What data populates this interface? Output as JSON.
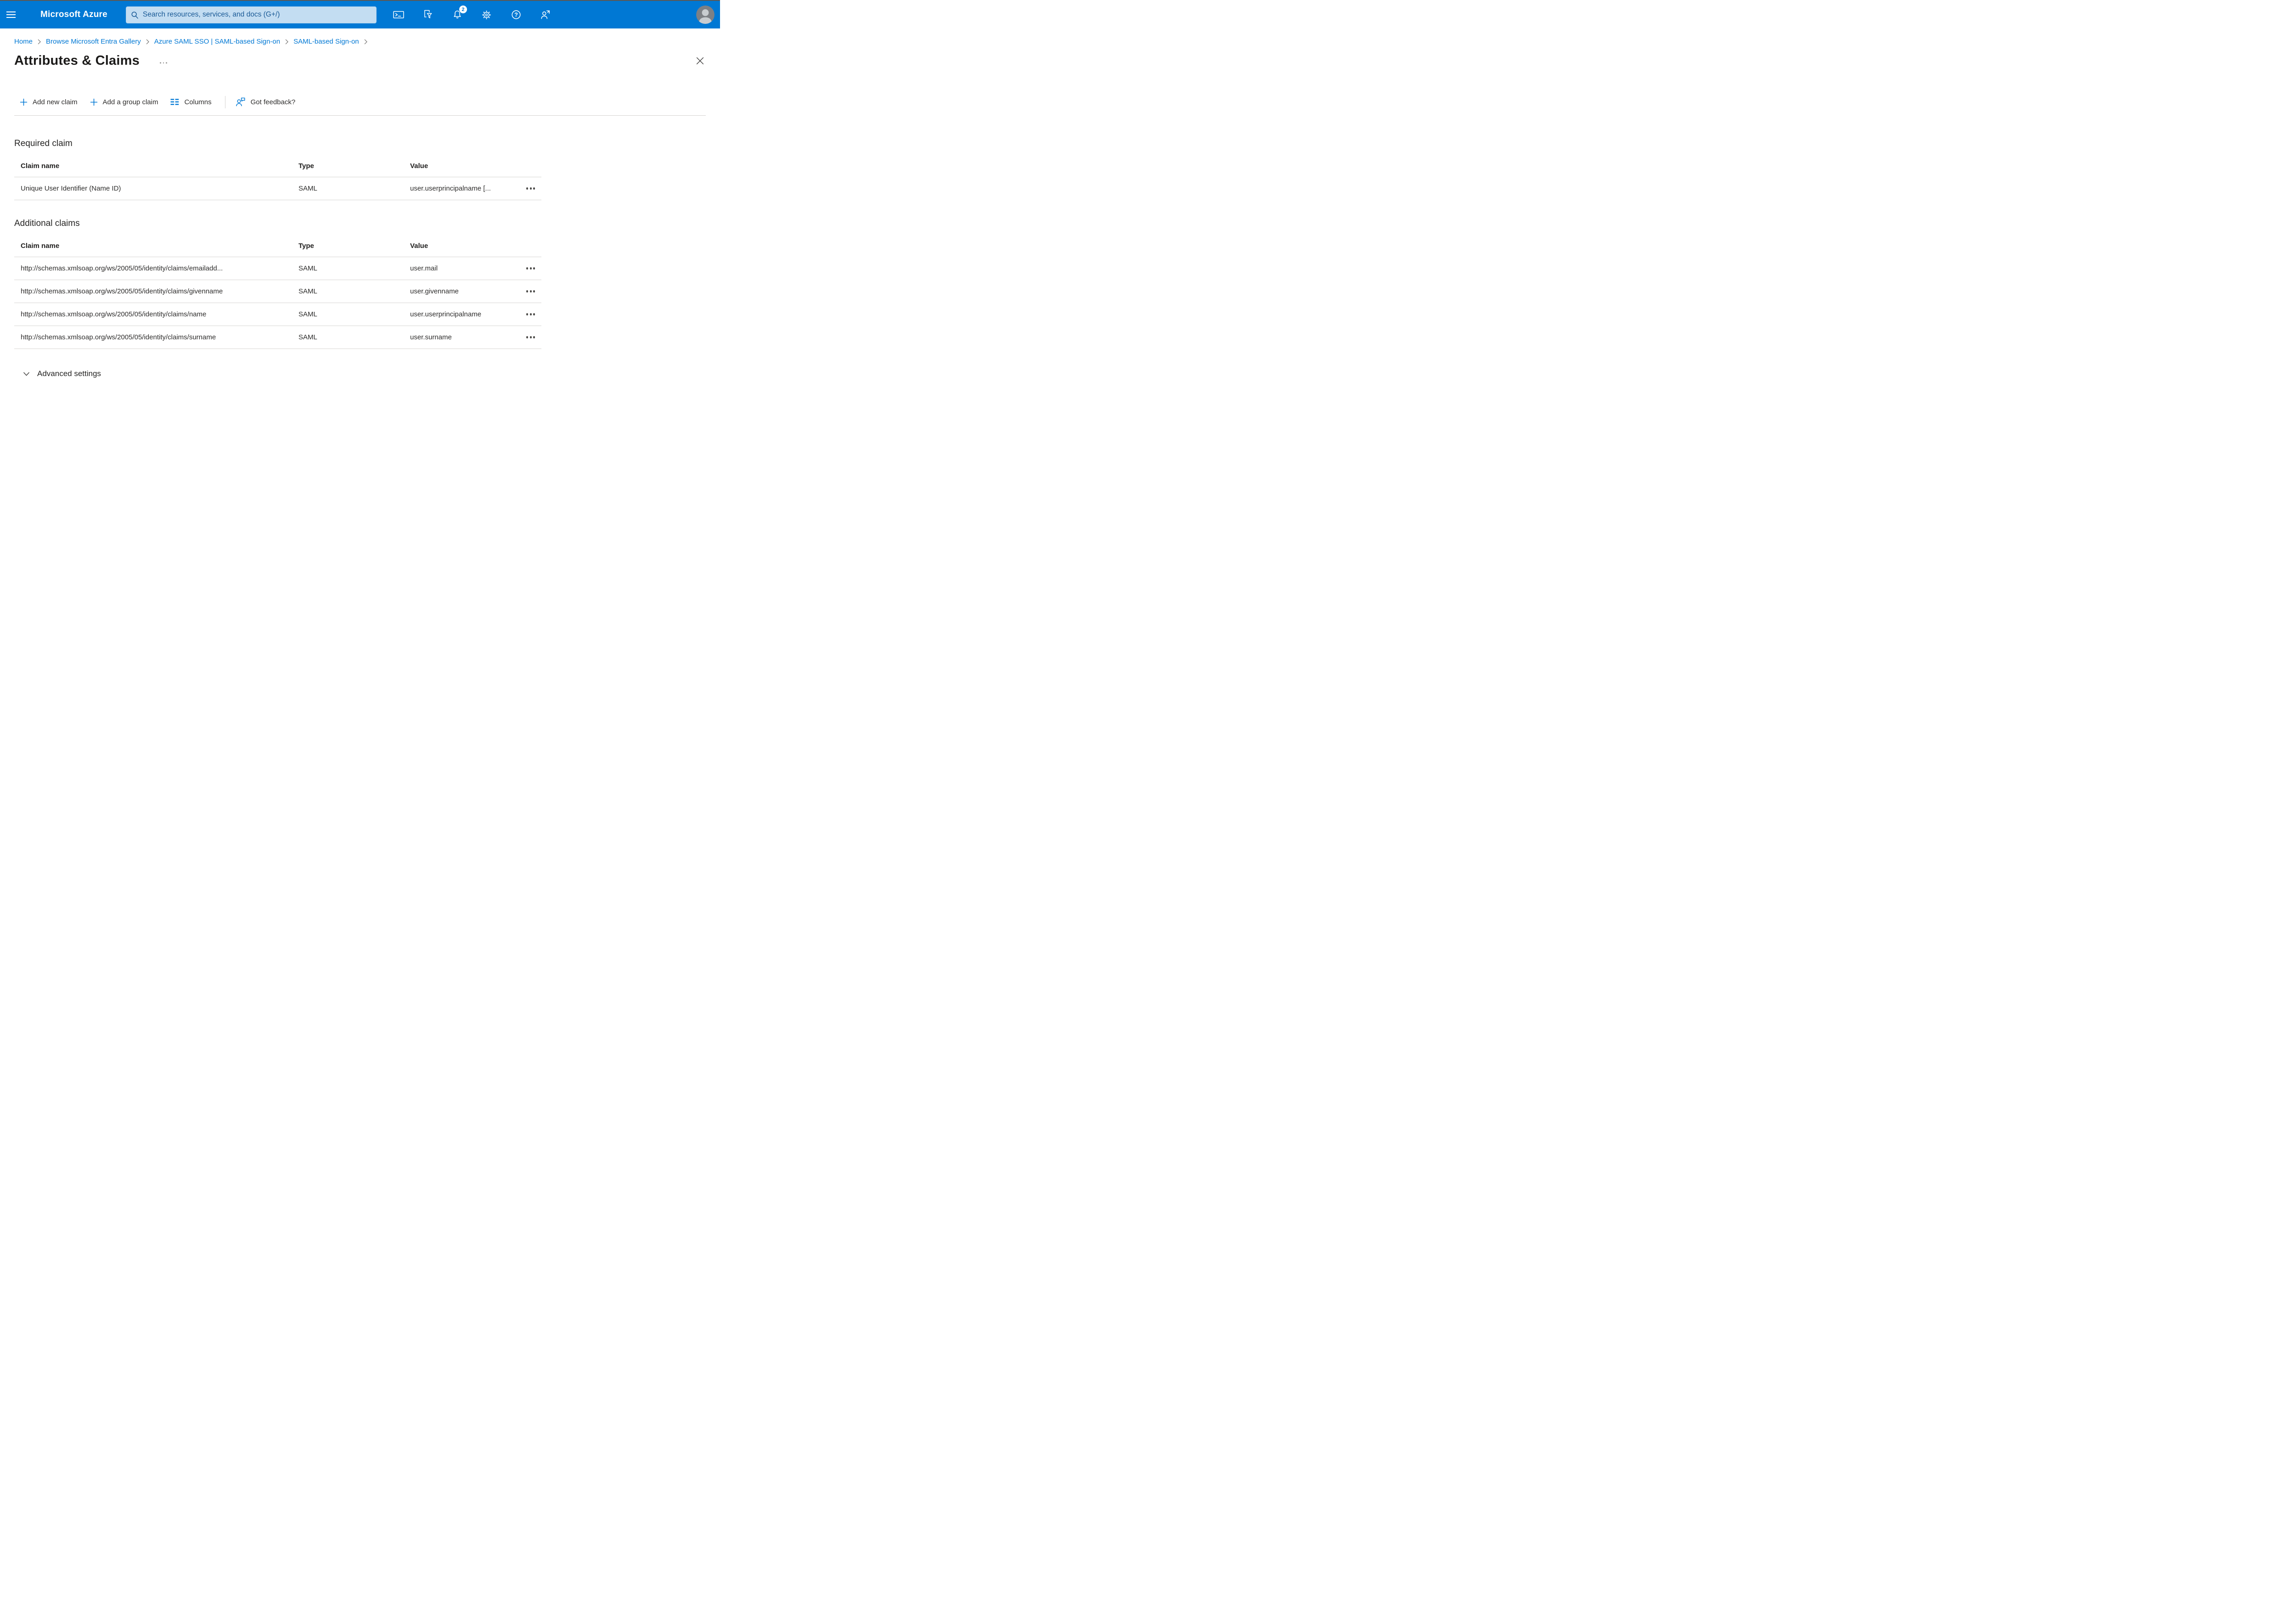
{
  "topbar": {
    "brand": "Microsoft Azure",
    "search_placeholder": "Search resources, services, and docs (G+/)",
    "notification_count": "2",
    "icons": [
      "hamburger-menu-icon",
      "search-icon",
      "cloud-shell-icon",
      "directory-filter-icon",
      "notifications-bell-icon",
      "settings-gear-icon",
      "help-icon",
      "person-arrow-icon",
      "avatar"
    ]
  },
  "colors": {
    "accent": "#0078d4",
    "topbar": "#0078d4",
    "search_bg": "#c3ddf2",
    "search_text": "#1a5a96"
  },
  "breadcrumb": {
    "items": [
      {
        "label": "Home"
      },
      {
        "label": "Browse Microsoft Entra Gallery"
      },
      {
        "label": "Azure SAML SSO | SAML-based Sign-on"
      },
      {
        "label": "SAML-based Sign-on"
      }
    ]
  },
  "page": {
    "title": "Attributes & Claims"
  },
  "toolbar": {
    "add_new_claim": "Add new claim",
    "add_group_claim": "Add a group claim",
    "columns": "Columns",
    "got_feedback": "Got feedback?"
  },
  "required_claim": {
    "heading": "Required claim",
    "columns": {
      "claim_name": "Claim name",
      "type": "Type",
      "value": "Value"
    },
    "rows": [
      {
        "claim_name": "Unique User Identifier (Name ID)",
        "type": "SAML",
        "value": "user.userprincipalname [..."
      }
    ]
  },
  "additional_claims": {
    "heading": "Additional claims",
    "columns": {
      "claim_name": "Claim name",
      "type": "Type",
      "value": "Value"
    },
    "rows": [
      {
        "claim_name": "http://schemas.xmlsoap.org/ws/2005/05/identity/claims/emailadd...",
        "type": "SAML",
        "value": "user.mail"
      },
      {
        "claim_name": "http://schemas.xmlsoap.org/ws/2005/05/identity/claims/givenname",
        "type": "SAML",
        "value": "user.givenname"
      },
      {
        "claim_name": "http://schemas.xmlsoap.org/ws/2005/05/identity/claims/name",
        "type": "SAML",
        "value": "user.userprincipalname"
      },
      {
        "claim_name": "http://schemas.xmlsoap.org/ws/2005/05/identity/claims/surname",
        "type": "SAML",
        "value": "user.surname"
      }
    ]
  },
  "advanced_settings": {
    "label": "Advanced settings"
  }
}
